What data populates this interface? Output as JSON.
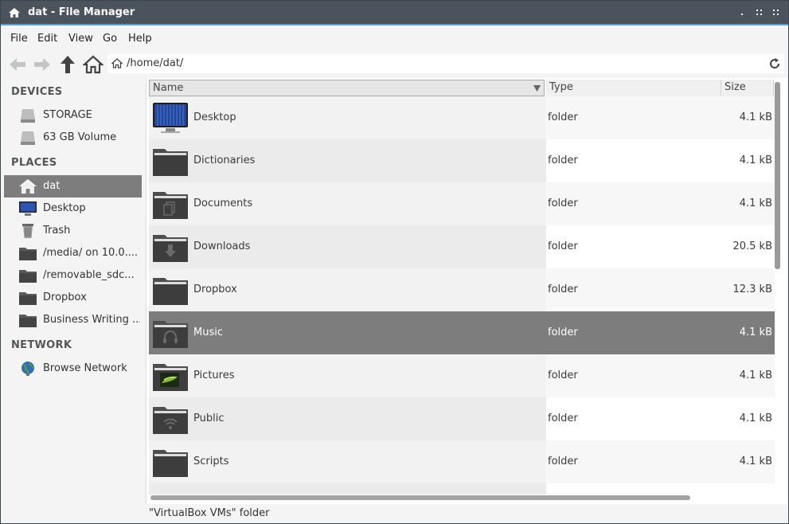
{
  "window": {
    "title": "dat - File Manager"
  },
  "menu": [
    "File",
    "Edit",
    "View",
    "Go",
    "Help"
  ],
  "location": {
    "path": "/home/dat/"
  },
  "sidebar": {
    "devices_header": "DEVICES",
    "devices": [
      {
        "label": "STORAGE",
        "icon": "drive-icon"
      },
      {
        "label": "63 GB Volume",
        "icon": "drive-icon"
      }
    ],
    "places_header": "PLACES",
    "places": [
      {
        "label": "dat",
        "icon": "home-icon",
        "selected": true
      },
      {
        "label": "Desktop",
        "icon": "desktop-icon"
      },
      {
        "label": "Trash",
        "icon": "trash-icon"
      },
      {
        "label": "/media/ on 10.0....",
        "icon": "network-folder-icon"
      },
      {
        "label": "/removable_sdc...",
        "icon": "network-folder-icon"
      },
      {
        "label": "Dropbox",
        "icon": "folder-icon"
      },
      {
        "label": "Business Writing ...",
        "icon": "folder-icon"
      }
    ],
    "network_header": "NETWORK",
    "network": [
      {
        "label": "Browse Network",
        "icon": "globe-icon"
      }
    ]
  },
  "columns": {
    "name": "Name",
    "type": "Type",
    "size": "Size"
  },
  "files": [
    {
      "name": "Desktop",
      "type": "folder",
      "size": "4.1 kB",
      "icon": "desktop-folder-icon"
    },
    {
      "name": "Dictionaries",
      "type": "folder",
      "size": "4.1 kB",
      "icon": "folder-icon"
    },
    {
      "name": "Documents",
      "type": "folder",
      "size": "4.1 kB",
      "icon": "documents-folder-icon"
    },
    {
      "name": "Downloads",
      "type": "folder",
      "size": "20.5 kB",
      "icon": "downloads-folder-icon"
    },
    {
      "name": "Dropbox",
      "type": "folder",
      "size": "12.3 kB",
      "icon": "folder-icon"
    },
    {
      "name": "Music",
      "type": "folder",
      "size": "4.1 kB",
      "icon": "music-folder-icon",
      "selected": true
    },
    {
      "name": "Pictures",
      "type": "folder",
      "size": "4.1 kB",
      "icon": "pictures-folder-icon"
    },
    {
      "name": "Public",
      "type": "folder",
      "size": "4.1 kB",
      "icon": "public-folder-icon"
    },
    {
      "name": "Scripts",
      "type": "folder",
      "size": "4.1 kB",
      "icon": "folder-icon"
    }
  ],
  "status": "\"VirtualBox VMs\" folder",
  "colors": {
    "accent": "#5aa0d8",
    "titlebar": "#4b545c",
    "selection": "#7d7d7d"
  }
}
